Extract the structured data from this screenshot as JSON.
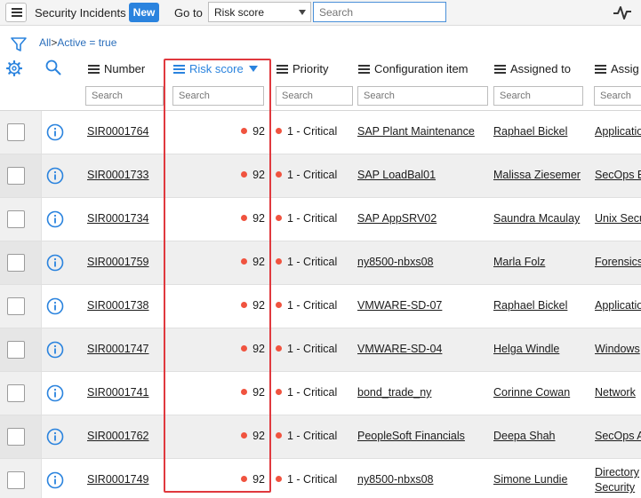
{
  "header": {
    "menu_icon": "hamburger-icon",
    "title": "Security Incidents",
    "new_label": "New",
    "goto_label": "Go to",
    "goto_selected": "Risk score",
    "search_placeholder": "Search",
    "activity_icon": "pulse-icon"
  },
  "breadcrumb": {
    "all": "All",
    "separator": ">",
    "filter": "Active = true"
  },
  "columns": [
    {
      "label": "Number"
    },
    {
      "label": "Risk score",
      "sorted": "desc"
    },
    {
      "label": "Priority"
    },
    {
      "label": "Configuration item"
    },
    {
      "label": "Assigned to"
    },
    {
      "label": "Assig"
    }
  ],
  "column_search_placeholder": "Search",
  "colors": {
    "accent": "#2a83de",
    "critical_dot": "#f0533f",
    "highlight_border": "#e0393e"
  },
  "rows": [
    {
      "number": "SIR0001764",
      "score": "92",
      "priority": "1 - Critical",
      "ci": "SAP Plant Maintenance",
      "assigned": "Raphael Bickel",
      "group": "Applicatio"
    },
    {
      "number": "SIR0001733",
      "score": "92",
      "priority": "1 - Critical",
      "ci": "SAP LoadBal01",
      "assigned": "Malissa Ziesemer",
      "group": "SecOps E"
    },
    {
      "number": "SIR0001734",
      "score": "92",
      "priority": "1 - Critical",
      "ci": "SAP AppSRV02",
      "assigned": "Saundra Mcaulay",
      "group": "Unix Secu"
    },
    {
      "number": "SIR0001759",
      "score": "92",
      "priority": "1 - Critical",
      "ci": "ny8500-nbxs08",
      "assigned": "Marla Folz",
      "group": "Forensics"
    },
    {
      "number": "SIR0001738",
      "score": "92",
      "priority": "1 - Critical",
      "ci": "VMWARE-SD-07",
      "assigned": "Raphael Bickel",
      "group": "Applicatio"
    },
    {
      "number": "SIR0001747",
      "score": "92",
      "priority": "1 - Critical",
      "ci": "VMWARE-SD-04",
      "assigned": "Helga Windle",
      "group": "Windows"
    },
    {
      "number": "SIR0001741",
      "score": "92",
      "priority": "1 - Critical",
      "ci": "bond_trade_ny",
      "assigned": "Corinne Cowan",
      "group": "Network"
    },
    {
      "number": "SIR0001762",
      "score": "92",
      "priority": "1 - Critical",
      "ci": "PeopleSoft Financials",
      "assigned": "Deepa Shah",
      "group": "SecOps A"
    },
    {
      "number": "SIR0001749",
      "score": "92",
      "priority": "1 - Critical",
      "ci": "ny8500-nbxs08",
      "assigned": "Simone Lundie",
      "group": "Directory Security"
    }
  ]
}
